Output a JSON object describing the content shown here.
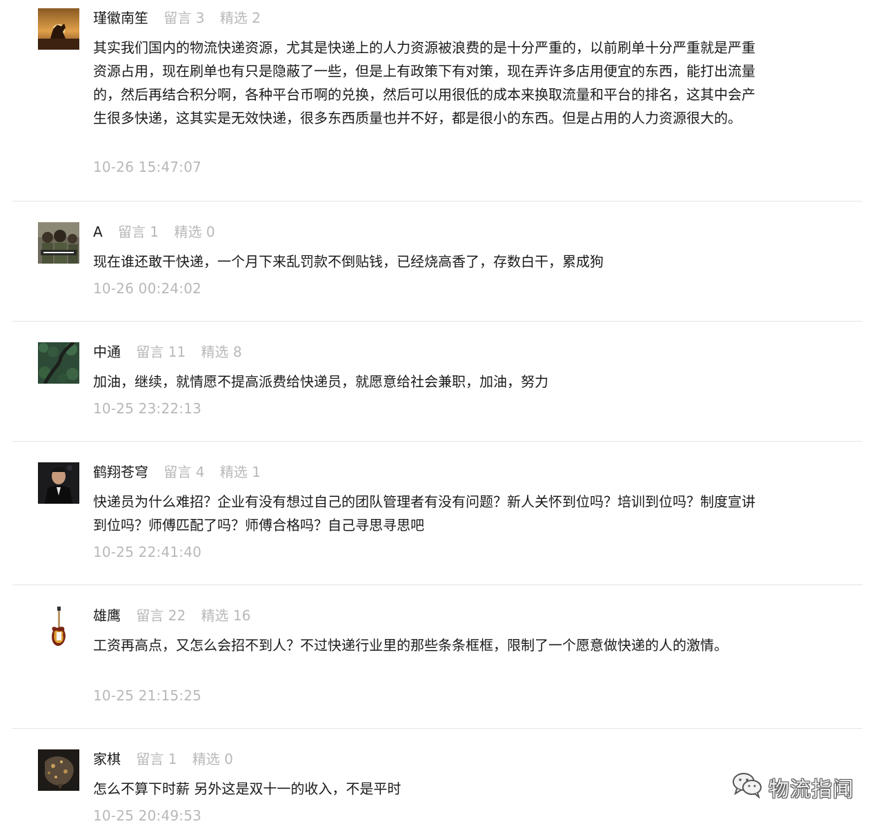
{
  "comments": [
    {
      "author": "瑾徽南笙",
      "liuyan": "留言 3",
      "jingxuan": "精选 2",
      "text": "其实我们国内的物流快递资源，尤其是快递上的人力资源被浪费的是十分严重的，以前刷单十分严重就是严重资源占用，现在刷单也有只是隐蔽了一些，但是上有政策下有对策，现在弄许多店用便宜的东西，能打出流量的，然后再结合积分啊，各种平台币啊的兑换，然后可以用很低的成本来换取流量和平台的排名，这其中会产生很多快递，这其实是无效快递，很多东西质量也并不好，都是很小的东西。但是占用的人力资源很大的。",
      "time": "10-26 15:47:07",
      "avatar": "avatar-sunset-horse"
    },
    {
      "author": "A",
      "liuyan": "留言 1",
      "jingxuan": "精选 0",
      "text": "现在谁还敢干快递，一个月下来乱罚款不倒贴钱，已经烧高香了，存数白干，累成狗",
      "time": "10-26 00:24:02",
      "avatar": "avatar-soldiers"
    },
    {
      "author": "中通",
      "liuyan": "留言 11",
      "jingxuan": "精选 8",
      "text": "加油，继续，就情愿不提高派费给快递员，就愿意给社会兼职，加油，努力",
      "time": "10-25 23:22:13",
      "avatar": "avatar-forest-road"
    },
    {
      "author": "鹤翔苍穹",
      "liuyan": "留言 4",
      "jingxuan": "精选 1",
      "text": "快递员为什么难招？企业有没有想过自己的团队管理者有没有问题？新人关怀到位吗？培训到位吗？制度宣讲到位吗？师傅匹配了吗？师傅合格吗？自己寻思寻思吧",
      "time": "10-25 22:41:40",
      "avatar": "avatar-man-suit"
    },
    {
      "author": "雄鹰",
      "liuyan": "留言 22",
      "jingxuan": "精选 16",
      "text": "工资再高点，又怎么会招不到人？不过快递行业里的那些条条框框，限制了一个愿意做快递的人的激情。",
      "time": "10-25 21:15:25",
      "avatar": "avatar-guitar"
    },
    {
      "author": "家棋",
      "liuyan": "留言 1",
      "jingxuan": "精选 0",
      "text": "怎么不算下时薪 另外这是双十一的收入，不是平时",
      "time": "10-25 20:49:53",
      "avatar": "avatar-dark-art"
    }
  ],
  "watermark": {
    "icon": "wechat-icon",
    "text": "物流指闻"
  }
}
